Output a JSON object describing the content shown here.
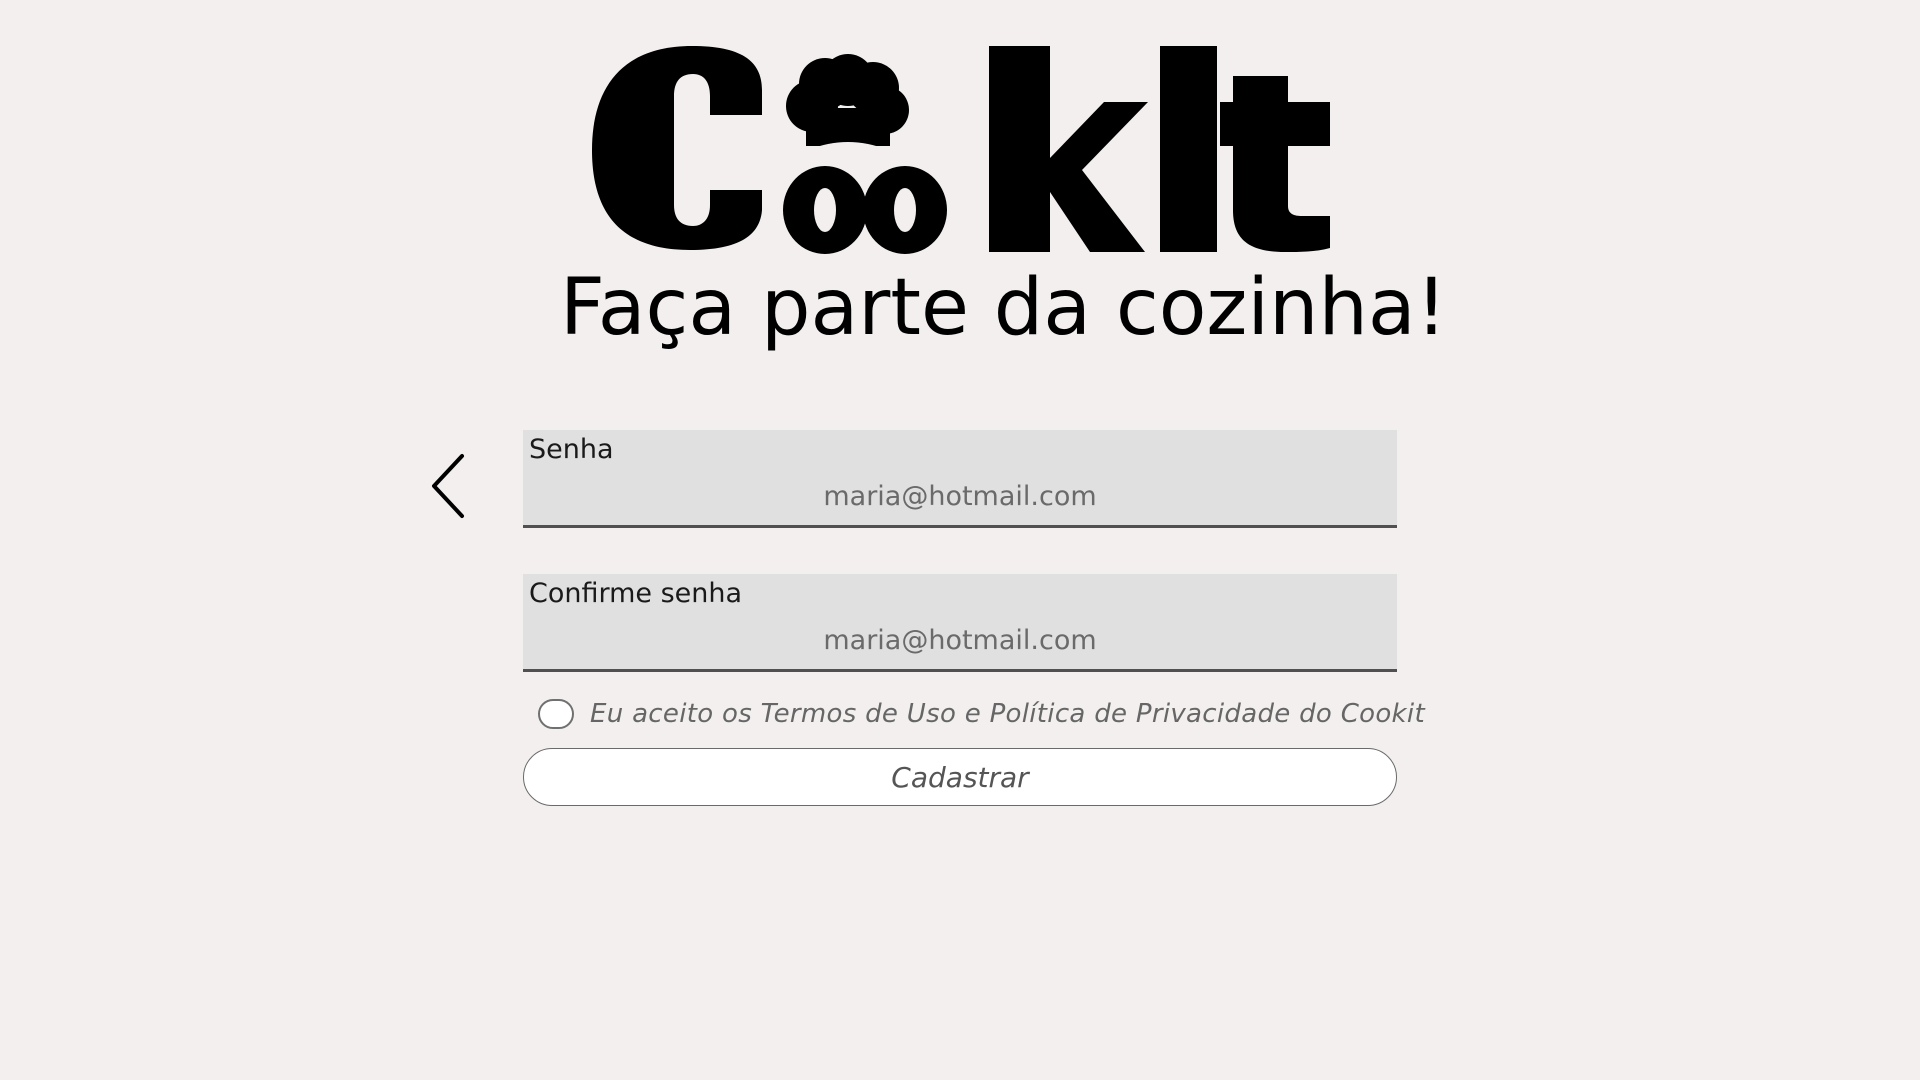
{
  "logo": {
    "text": "CooKIt",
    "color": "#000000",
    "icon": "chef-hat-icon"
  },
  "tagline": "Faça parte da cozinha!",
  "back_button": {
    "icon": "chevron-left-icon"
  },
  "password_field": {
    "label": "Senha",
    "placeholder": "maria@hotmail.com"
  },
  "confirm_password_field": {
    "label": "Confirme senha",
    "placeholder": "maria@hotmail.com"
  },
  "terms": {
    "checked": false,
    "text": "Eu aceito os Termos de Uso e Política de Privacidade do Cookit"
  },
  "submit_button": {
    "label": "Cadastrar"
  },
  "colors": {
    "background": "#f2efee",
    "field_background": "#e0e0e0",
    "field_underline": "#505050",
    "text_primary": "#000000",
    "text_secondary": "#666666"
  }
}
